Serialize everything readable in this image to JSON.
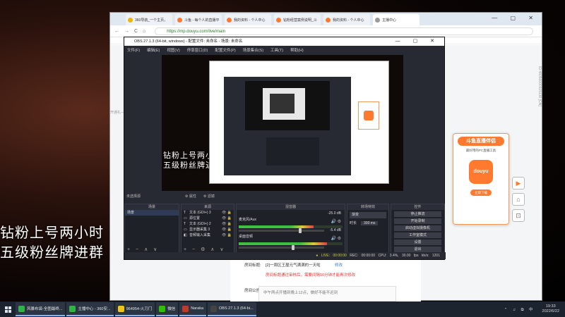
{
  "stream_overlay": {
    "line1": "钻粉上号两小时",
    "line2": "五级粉丝牌进群"
  },
  "browser": {
    "tabs": [
      {
        "label": "360导航_一个主页，",
        "color": "#f0b400",
        "active": false
      },
      {
        "label": "斗鱼 - 每个人的直播平",
        "color": "#ff7a2f",
        "active": false
      },
      {
        "label": "我的资料 - 个人中心",
        "color": "#ff7a2f",
        "active": false
      },
      {
        "label": "钻粉经营案例说明_斗",
        "color": "#ff7a2f",
        "active": false
      },
      {
        "label": "我的资料 - 个人中心",
        "color": "#ff7a2f",
        "active": false
      },
      {
        "label": "主播中心",
        "color": "#999999",
        "active": true
      }
    ],
    "window_controls": "— ▢ ✕",
    "nav": {
      "back": "←",
      "forward": "→",
      "reload": "C",
      "home": "⌂"
    },
    "url": "https://mp.douyu.com/live/main",
    "page": {
      "side_text": "开通礼—键",
      "form": {
        "title_label": "房间标题:",
        "title_value": "[2]一周区王屋元气满满的一天啦",
        "edit": "修改",
        "warning": "房间标题通过审核后，需要间隔10分钟才能再次修改",
        "notice_label": "房间公告:",
        "notice_value": "中午两点开播到晚上12点，做好不能不迟到"
      },
      "promo": {
        "heading": "斗鱼直播伴侣",
        "subtitle": "最好用的PC直播工具",
        "logo": "douyu",
        "button": "立即下载"
      },
      "float_icons": [
        "play-icon",
        "home-icon",
        "broadcast-icon"
      ],
      "vertical_id": "ID:46050000315130 [CN]"
    }
  },
  "obs": {
    "title": "OBS 27.1.3 (64-bit, windows) - 配置文件: 未命名 - 场景: 未命名",
    "window_controls": "— ▢ ✕",
    "menu": [
      "文件(F)",
      "编辑(E)",
      "视图(V)",
      "停靠窗口(D)",
      "配置文件(P)",
      "场景集合(S)",
      "工具(T)",
      "帮助(H)"
    ],
    "preview_overlay": {
      "line1": "钻粉上号两小时",
      "line2": "五级粉丝牌进群"
    },
    "scene_label": "未选择源",
    "scene_buttons": [
      "⚙ 属性",
      "⚙ 滤镜"
    ],
    "docks": {
      "scenes": {
        "title": "场景",
        "items": [
          "场景"
        ],
        "footer": "+ − ∧ ∨"
      },
      "sources": {
        "title": "来源",
        "items": [
          {
            "icon": "T",
            "label": "文本 (GDI+) 3"
          },
          {
            "icon": "▭",
            "label": "源位置"
          },
          {
            "icon": "T",
            "label": "文本 (GDI+) 2"
          },
          {
            "icon": "▭",
            "label": "显示器采集 3"
          },
          {
            "icon": "◧",
            "label": "音频输入采集"
          }
        ],
        "footer": "+ − ⚙ ∧ ∨"
      },
      "mixer": {
        "title": "混音器",
        "tracks": [
          {
            "name": "麦克风/Aux",
            "db": "-25.0 dB",
            "level": 0.72,
            "volume": 0.7
          },
          {
            "name": "桌面音频",
            "db": "-5.4 dB",
            "level": 0.85,
            "volume": 0.62
          }
        ]
      },
      "transitions": {
        "title": "转场特效",
        "type": "渐变",
        "duration_label": "时长",
        "duration": "300 ms"
      },
      "controls": {
        "title": "控件",
        "buttons": [
          "停止推流",
          "开始录制",
          "启动虚拟摄像机",
          "工作室模式",
          "设置",
          "退出"
        ]
      }
    },
    "status": {
      "live": "● LIVE: 00:00:00",
      "rec": "REC: 00:00:00",
      "cpu": "CPU: 3.4%, 30.00 fps",
      "bitrate": "kb/s: 1201"
    }
  },
  "taskbar": {
    "apps": [
      {
        "label": "风暴布袋-全图最终...",
        "color": "#2fb344",
        "open": true
      },
      {
        "label": "主播中心 - 360安...",
        "color": "#2fb344",
        "open": true
      },
      {
        "label": "964954-火刀门",
        "color": "#f0c419",
        "open": true
      },
      {
        "label": "微信",
        "color": "#2dc100",
        "open": true
      },
      {
        "label": "Naraka",
        "color": "#c0392b",
        "open": true
      },
      {
        "label": "OBS 27.1.3 (64-bi...",
        "color": "#444444",
        "open": true
      }
    ],
    "tray_icons": "⌃ ♫ ⧉ 中",
    "time": "19:33",
    "date": "2022/6/22"
  }
}
